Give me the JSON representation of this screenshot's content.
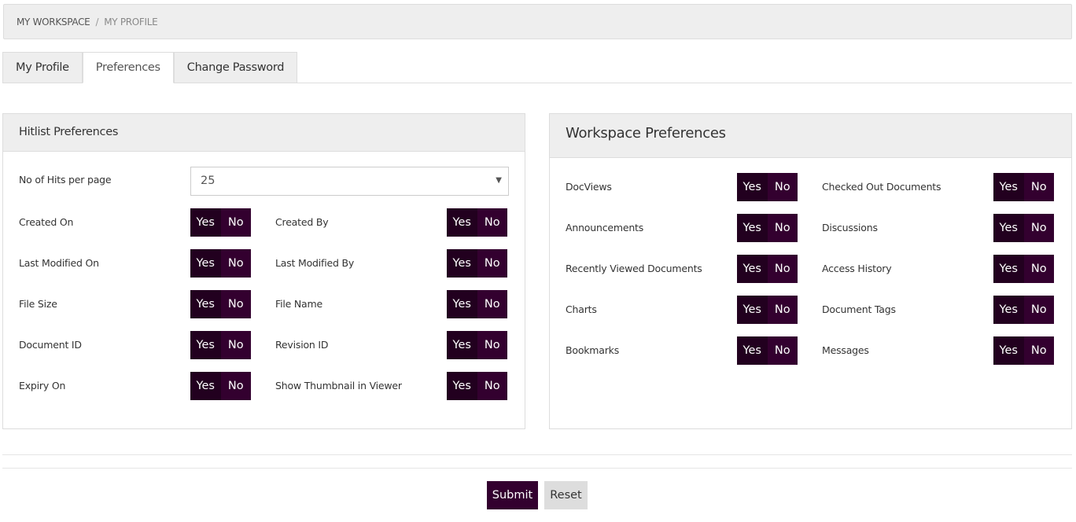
{
  "breadcrumb": {
    "items": [
      "MY WORKSPACE",
      "MY PROFILE"
    ],
    "separator": "/"
  },
  "tabs": [
    {
      "label": "My Profile"
    },
    {
      "label": "Preferences",
      "active": true
    },
    {
      "label": "Change Password"
    }
  ],
  "hitlist": {
    "title": "Hitlist Preferences",
    "hits_label": "No of Hits per page",
    "hits_value": "25",
    "rows": [
      [
        {
          "label": "Created On"
        },
        {
          "label": "Created By"
        }
      ],
      [
        {
          "label": "Last Modified On"
        },
        {
          "label": "Last Modified By"
        }
      ],
      [
        {
          "label": "File Size"
        },
        {
          "label": "File Name"
        }
      ],
      [
        {
          "label": "Document ID"
        },
        {
          "label": "Revision ID"
        }
      ],
      [
        {
          "label": "Expiry On"
        },
        {
          "label": "Show Thumbnail in Viewer"
        }
      ]
    ]
  },
  "workspace": {
    "title": "Workspace Preferences",
    "rows": [
      [
        {
          "label": "DocViews"
        },
        {
          "label": "Checked Out Documents"
        }
      ],
      [
        {
          "label": "Announcements"
        },
        {
          "label": "Discussions"
        }
      ],
      [
        {
          "label": "Recently Viewed Documents"
        },
        {
          "label": "Access History"
        }
      ],
      [
        {
          "label": "Charts"
        },
        {
          "label": "Document Tags"
        }
      ],
      [
        {
          "label": "Bookmarks"
        },
        {
          "label": "Messages"
        }
      ]
    ]
  },
  "toggle": {
    "yes": "Yes",
    "no": "No"
  },
  "actions": {
    "submit": "Submit",
    "reset": "Reset"
  },
  "colors": {
    "accent": "#33002f",
    "accent_dark": "#22001f",
    "reset_bg": "#dddddd"
  }
}
